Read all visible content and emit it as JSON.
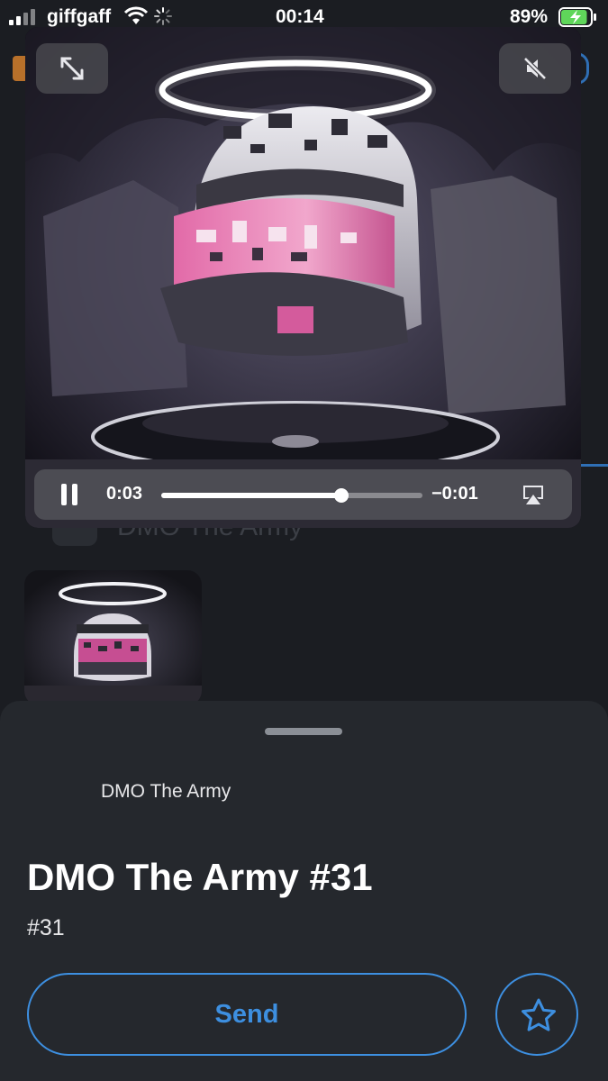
{
  "status_bar": {
    "carrier": "giffgaff",
    "time": "00:14",
    "battery_percent": "89%",
    "battery_level": 0.89,
    "battery_charging": true
  },
  "player": {
    "elapsed": "0:03",
    "remaining": "−0:01",
    "progress": 0.69,
    "muted": true
  },
  "background_page": {
    "collection_label": "DMO The Army"
  },
  "nft": {
    "collection": "DMO The Army",
    "title": "DMO The Army #31",
    "token_number": "#31"
  },
  "actions": {
    "send_label": "Send",
    "favorite_icon": "star-icon"
  },
  "colors": {
    "accent": "#3d8fe0",
    "sheet_bg": "#25282d",
    "page_bg": "#1b1d22",
    "battery_green": "#5fd65a"
  }
}
